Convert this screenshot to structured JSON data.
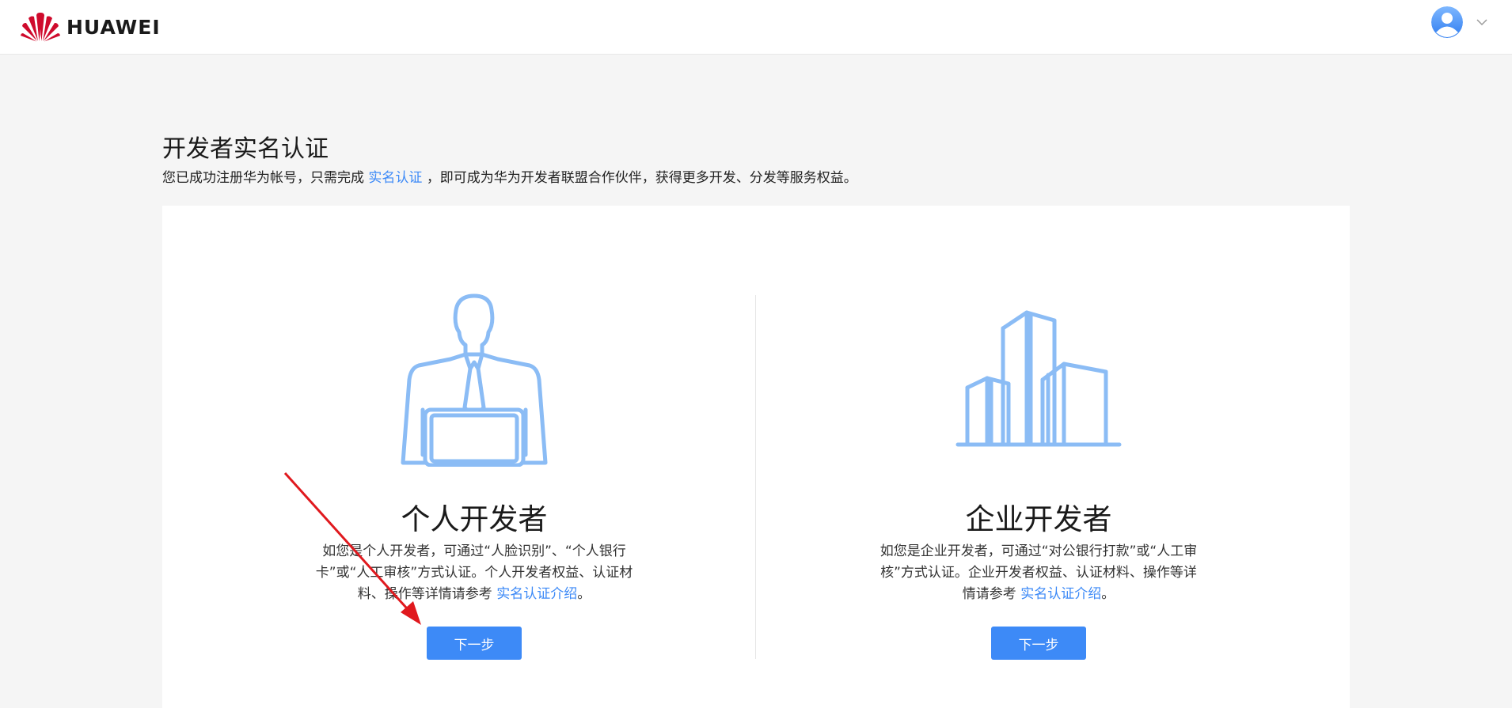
{
  "header": {
    "brand": "HUAWEI",
    "brand_color": "#cf0a2c",
    "avatar_icon": "user-avatar-icon",
    "menu_icon": "chevron-down-icon"
  },
  "page": {
    "title": "开发者实名认证",
    "subtitle_before": "您已成功注册华为帐号，只需完成",
    "subtitle_link": "实名认证",
    "subtitle_after": "，即可成为华为开发者联盟合作伙伴，获得更多开发、分发等服务权益。"
  },
  "options": [
    {
      "icon": "developer-person-icon",
      "title": "个人开发者",
      "desc_before": "如您是个人开发者，可通过“人脸识别”、“个人银行卡”或“人工审核”方式认证。个人开发者权益、认证材料、操作等详情请参考",
      "desc_link": "实名认证介绍",
      "desc_after": "。",
      "button_label": "下一步"
    },
    {
      "icon": "enterprise-building-icon",
      "title": "企业开发者",
      "desc_before": "如您是企业开发者，可通过“对公银行打款”或“人工审核”方式认证。企业开发者权益、认证材料、操作等详情请参考",
      "desc_link": "实名认证介绍",
      "desc_after": "。",
      "button_label": "下一步"
    }
  ],
  "colors": {
    "accent": "#3d8af7",
    "illustration": "#8bbcf5",
    "annotation_arrow": "#e0191e",
    "background": "#f5f5f5"
  }
}
